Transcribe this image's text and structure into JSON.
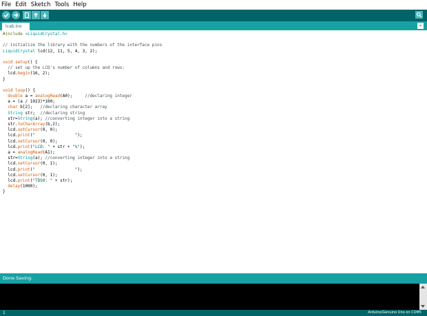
{
  "menu": [
    "File",
    "Edit",
    "Sketch",
    "Tools",
    "Help"
  ],
  "toolbar": {
    "buttons": [
      {
        "name": "verify-button",
        "icon": "checkmark-icon"
      },
      {
        "name": "upload-button",
        "icon": "arrow-right-icon"
      },
      {
        "name": "new-button",
        "icon": "new-file-icon"
      },
      {
        "name": "open-button",
        "icon": "arrow-up-icon"
      },
      {
        "name": "save-button",
        "icon": "arrow-down-icon"
      }
    ],
    "serial_monitor_icon": "magnifier-icon"
  },
  "tab": {
    "label": "lcab.ino"
  },
  "code": [
    [
      [
        "pp",
        "#include "
      ],
      [
        "ty",
        "<LiquidCrystal.h>"
      ]
    ],
    [],
    [
      [
        "cm",
        "// initialize the library with the numbers of the interface pins"
      ]
    ],
    [
      [
        "ty",
        "LiquidCrystal"
      ],
      [
        "",
        " lcd(12, 11, 5, 4, 3, 2);"
      ]
    ],
    [],
    [
      [
        "kw",
        "void"
      ],
      [
        "",
        " "
      ],
      [
        "fn",
        "setup"
      ],
      [
        "",
        "() {"
      ]
    ],
    [
      [
        "",
        "  "
      ],
      [
        "cm",
        "// set up the LCD's number of columns and rows:"
      ]
    ],
    [
      [
        "",
        "  lcd."
      ],
      [
        "fn",
        "begin"
      ],
      [
        "",
        "(16, 2);"
      ]
    ],
    [
      [
        "",
        "}"
      ]
    ],
    [],
    [
      [
        "kw",
        "void"
      ],
      [
        "",
        " "
      ],
      [
        "fn",
        "loop"
      ],
      [
        "",
        "() {"
      ]
    ],
    [
      [
        "",
        "  "
      ],
      [
        "kw",
        "double"
      ],
      [
        "",
        " a = "
      ],
      [
        "fn",
        "analogRead"
      ],
      [
        "",
        "(A0);     "
      ],
      [
        "cm",
        "//declaring integer"
      ]
    ],
    [
      [
        "",
        "  a = (a / 1023)*100;"
      ]
    ],
    [
      [
        "",
        "  "
      ],
      [
        "kw",
        "char"
      ],
      [
        "",
        " b[2];   "
      ],
      [
        "cm",
        "//declaring character array"
      ]
    ],
    [
      [
        "",
        "  "
      ],
      [
        "ty",
        "String"
      ],
      [
        "",
        " str;  "
      ],
      [
        "cm",
        "//declaring string"
      ]
    ],
    [
      [
        "",
        "  str="
      ],
      [
        "ty",
        "String"
      ],
      [
        "",
        "(a); "
      ],
      [
        "cm",
        "//converting integer into a string"
      ]
    ],
    [
      [
        "",
        "  str."
      ],
      [
        "fn",
        "toCharArray"
      ],
      [
        "",
        "(b,2);"
      ]
    ],
    [
      [
        "",
        "  lcd."
      ],
      [
        "fn",
        "setCursor"
      ],
      [
        "",
        "(0, 0);"
      ]
    ],
    [
      [
        "",
        "  lcd."
      ],
      [
        "fn",
        "print"
      ],
      [
        "",
        "("
      ],
      [
        "st",
        "\"                \""
      ],
      [
        "",
        ");"
      ]
    ],
    [
      [
        "",
        "  lcd."
      ],
      [
        "fn",
        "setCursor"
      ],
      [
        "",
        "(0, 0);"
      ]
    ],
    [
      [
        "",
        "  lcd."
      ],
      [
        "fn",
        "print"
      ],
      [
        "",
        "("
      ],
      [
        "st",
        "\"LCD: \""
      ],
      [
        "",
        " + str + "
      ],
      [
        "st",
        "\"%\""
      ],
      [
        "",
        ");"
      ]
    ],
    [
      [
        "",
        "  a = "
      ],
      [
        "fn",
        "analogRead"
      ],
      [
        "",
        "(A1);"
      ]
    ],
    [
      [
        "",
        "  str="
      ],
      [
        "ty",
        "String"
      ],
      [
        "",
        "(a); "
      ],
      [
        "cm",
        "//converting integer into a string"
      ]
    ],
    [
      [
        "",
        "  lcd."
      ],
      [
        "fn",
        "setCursor"
      ],
      [
        "",
        "(0, 1);"
      ]
    ],
    [
      [
        "",
        "  lcd."
      ],
      [
        "fn",
        "print"
      ],
      [
        "",
        "("
      ],
      [
        "st",
        "\"                \""
      ],
      [
        "",
        ");"
      ]
    ],
    [
      [
        "",
        "  lcd."
      ],
      [
        "fn",
        "setCursor"
      ],
      [
        "",
        "(0, 1);"
      ]
    ],
    [
      [
        "",
        "  lcd."
      ],
      [
        "fn",
        "print"
      ],
      [
        "",
        "("
      ],
      [
        "st",
        "\"TDS0: \""
      ],
      [
        "",
        " + str);"
      ]
    ],
    [
      [
        "",
        "  "
      ],
      [
        "fn",
        "delay"
      ],
      [
        "",
        "(1000);"
      ]
    ],
    [
      [
        "",
        "}"
      ]
    ]
  ],
  "status": {
    "message": "Done Saving."
  },
  "footer": {
    "line": "1",
    "board": "Arduino/Genuino Uno on COM5"
  },
  "colors": {
    "toolbar": "#006468",
    "tabbar": "#17a1a5",
    "button": "#4db7bb"
  }
}
